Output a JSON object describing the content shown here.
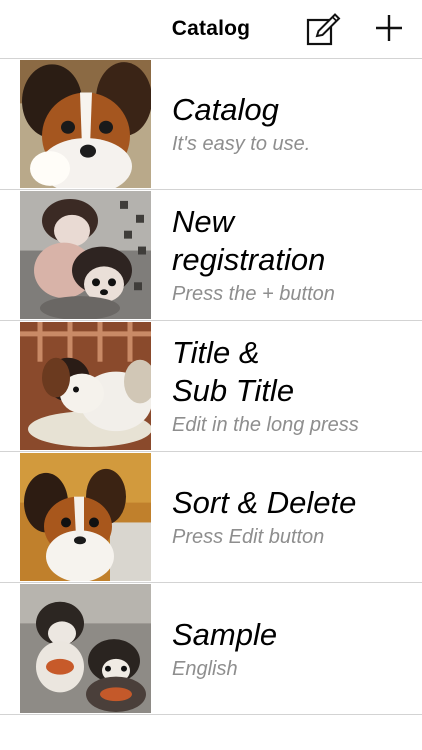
{
  "navbar": {
    "title": "Catalog",
    "edit_icon": "compose-icon",
    "add_icon": "plus-icon"
  },
  "rows": [
    {
      "title": "Catalog",
      "subtitle": "It's easy to use.",
      "image": "papillon-dog-closeup"
    },
    {
      "title": "New\nregistration",
      "subtitle": "Press the + button",
      "image": "two-papillon-dogs"
    },
    {
      "title": "Title &\nSub Title",
      "subtitle": "Edit in the long press",
      "image": "papillon-on-cushion"
    },
    {
      "title": "Sort & Delete",
      "subtitle": "Press Edit button",
      "image": "papillon-sitting"
    },
    {
      "title": "Sample",
      "subtitle": "English",
      "image": "two-dogs-outdoors"
    }
  ]
}
